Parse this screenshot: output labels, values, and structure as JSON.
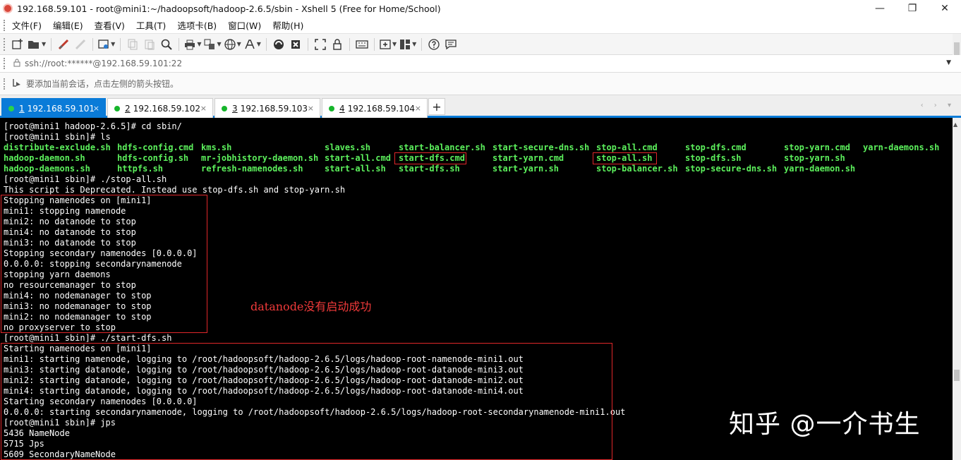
{
  "window": {
    "title": "192.168.59.101 - root@mini1:~/hadoopsoft/hadoop-2.6.5/sbin - Xshell 5 (Free for Home/School)",
    "minimize_label": "—",
    "maximize_label": "❐",
    "close_label": "✕"
  },
  "menu": {
    "items": [
      "文件(F)",
      "编辑(E)",
      "查看(V)",
      "工具(T)",
      "选项卡(B)",
      "窗口(W)",
      "帮助(H)"
    ]
  },
  "toolbar": {
    "icons": [
      "new-session-icon",
      "open-folder-icon",
      "reconnect-icon",
      "disconnect-icon",
      "properties-icon",
      "copy-icon",
      "paste-icon",
      "find-icon",
      "print-icon",
      "transfer-icon",
      "globe-icon",
      "font-icon",
      "xftp-icon",
      "xmanager-icon",
      "fullscreen-icon",
      "lock-icon",
      "keyboard-icon",
      "new-tab-icon",
      "layout-icon",
      "help-icon",
      "chat-icon"
    ]
  },
  "address": {
    "value": "ssh://root:******@192.168.59.101:22"
  },
  "hint": {
    "text": "要添加当前会话，点击左侧的箭头按钮。"
  },
  "tabs": [
    {
      "num": "1",
      "label": "192.168.59.101",
      "active": true
    },
    {
      "num": "2",
      "label": "192.168.59.102",
      "active": false
    },
    {
      "num": "3",
      "label": "192.168.59.103",
      "active": false
    },
    {
      "num": "4",
      "label": "192.168.59.104",
      "active": false
    }
  ],
  "tab_add": "+",
  "tab_close": "×",
  "terminal": {
    "line_cd": "[root@mini1 hadoop-2.6.5]# cd sbin/",
    "line_ls": "[root@mini1 sbin]# ls",
    "ls_row1": [
      "distribute-exclude.sh",
      "hdfs-config.cmd",
      "kms.sh",
      "slaves.sh",
      "start-balancer.sh",
      "start-secure-dns.sh",
      "stop-all.cmd",
      "stop-dfs.cmd",
      "stop-yarn.cmd",
      "yarn-daemons.sh"
    ],
    "ls_row2": [
      "hadoop-daemon.sh",
      "hdfs-config.sh",
      "mr-jobhistory-daemon.sh",
      "start-all.cmd",
      "start-dfs.cmd",
      "start-yarn.cmd",
      "stop-all.sh",
      "stop-dfs.sh",
      "stop-yarn.sh"
    ],
    "ls_row3": [
      "hadoop-daemons.sh",
      "httpfs.sh",
      "refresh-namenodes.sh",
      "start-all.sh",
      "start-dfs.sh",
      "start-yarn.sh",
      "stop-balancer.sh",
      "stop-secure-dns.sh",
      "yarn-daemon.sh"
    ],
    "output": [
      "[root@mini1 sbin]# ./stop-all.sh",
      "This script is Deprecated. Instead use stop-dfs.sh and stop-yarn.sh",
      "Stopping namenodes on [mini1]",
      "mini1: stopping namenode",
      "mini2: no datanode to stop",
      "mini4: no datanode to stop",
      "mini3: no datanode to stop",
      "Stopping secondary namenodes [0.0.0.0]",
      "0.0.0.0: stopping secondarynamenode",
      "stopping yarn daemons",
      "no resourcemanager to stop",
      "mini4: no nodemanager to stop",
      "mini3: no nodemanager to stop",
      "mini2: no nodemanager to stop",
      "no proxyserver to stop",
      "[root@mini1 sbin]# ./start-dfs.sh",
      "Starting namenodes on [mini1]",
      "mini1: starting namenode, logging to /root/hadoopsoft/hadoop-2.6.5/logs/hadoop-root-namenode-mini1.out",
      "mini3: starting datanode, logging to /root/hadoopsoft/hadoop-2.6.5/logs/hadoop-root-datanode-mini3.out",
      "mini2: starting datanode, logging to /root/hadoopsoft/hadoop-2.6.5/logs/hadoop-root-datanode-mini2.out",
      "mini4: starting datanode, logging to /root/hadoopsoft/hadoop-2.6.5/logs/hadoop-root-datanode-mini4.out",
      "Starting secondary namenodes [0.0.0.0]",
      "0.0.0.0: starting secondarynamenode, logging to /root/hadoopsoft/hadoop-2.6.5/logs/hadoop-root-secondarynamenode-mini1.out",
      "[root@mini1 sbin]# jps",
      "5436 NameNode",
      "5715 Jps",
      "5609 SecondaryNameNode"
    ],
    "annotation": "datanode没有启动成功",
    "watermark": "知乎 @一介书生"
  },
  "colors": {
    "terminal_bg": "#000000",
    "terminal_fg": "#ffffff",
    "ls_green": "#5cf05c",
    "annotation_red": "#e0272a",
    "tab_active": "#0a7bd8"
  }
}
